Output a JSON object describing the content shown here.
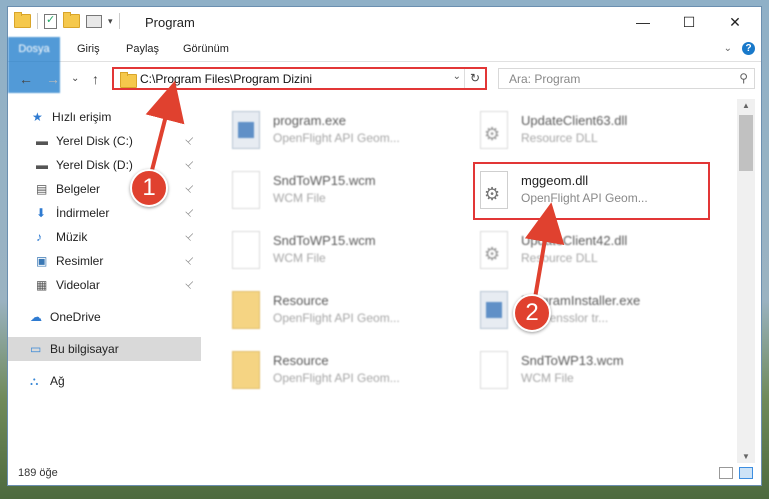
{
  "window": {
    "title": "Program",
    "controls": {
      "minimize": "—",
      "maximize": "☐",
      "close": "✕"
    }
  },
  "ribbon": {
    "tabs": [
      "Dosya",
      "Giriş",
      "Paylaş",
      "Görünüm"
    ],
    "help_label": "?"
  },
  "nav": {
    "back": "←",
    "forward": "→",
    "recent": "⌄",
    "up": "↑",
    "address": "C:\\Program Files\\Program Dizini",
    "search_placeholder": "Ara: Program"
  },
  "sidebar": {
    "items": [
      {
        "label": "Hızlı erişim",
        "icon": "star-icon",
        "pinned": false
      },
      {
        "label": "Yerel Disk (C:)",
        "icon": "drive-icon",
        "pinned": true
      },
      {
        "label": "Yerel Disk (D:)",
        "icon": "drive-icon",
        "pinned": true
      },
      {
        "label": "Belgeler",
        "icon": "documents-icon",
        "pinned": true
      },
      {
        "label": "İndirmeler",
        "icon": "download-icon",
        "pinned": true
      },
      {
        "label": "Müzik",
        "icon": "music-icon",
        "pinned": true
      },
      {
        "label": "Resimler",
        "icon": "pictures-icon",
        "pinned": true
      },
      {
        "label": "Videolar",
        "icon": "video-icon",
        "pinned": true
      },
      {
        "label": "OneDrive",
        "icon": "cloud-icon",
        "pinned": false
      },
      {
        "label": "Bu bilgisayar",
        "icon": "computer-icon",
        "pinned": false
      },
      {
        "label": "Ağ",
        "icon": "network-icon",
        "pinned": false
      }
    ],
    "pin_glyph": "📌"
  },
  "files": [
    {
      "name": "program.exe",
      "desc": "OpenFlight API Geom...",
      "type": "exe"
    },
    {
      "name": "UpdateClient63.dll",
      "desc": "Resource DLL",
      "type": "dll"
    },
    {
      "name": "SndToWP15.wcm",
      "desc": "WCM File",
      "type": "file"
    },
    {
      "name": "mggeom.dll",
      "desc": "OpenFlight API Geom...",
      "type": "dll"
    },
    {
      "name": "SndToWP15.wcm",
      "desc": "WCM File",
      "type": "file"
    },
    {
      "name": "UpdateClient42.dll",
      "desc": "Resource DLL",
      "type": "dll"
    },
    {
      "name": "Resource",
      "desc": "OpenFlight API Geom...",
      "type": "folder"
    },
    {
      "name": "ProgramInstaller.exe",
      "desc": "Y Yorensslor tr...",
      "type": "exe"
    },
    {
      "name": "Resource",
      "desc": "OpenFlight API Geom...",
      "type": "folder"
    },
    {
      "name": "SndToWP13.wcm",
      "desc": "WCM File",
      "type": "file"
    }
  ],
  "status": {
    "count": "189 öğe"
  },
  "annotations": {
    "step1": "1",
    "step2": "2"
  },
  "colors": {
    "accent": "#1979ca",
    "annotation": "#e0412f",
    "highlight": "#e23636"
  }
}
